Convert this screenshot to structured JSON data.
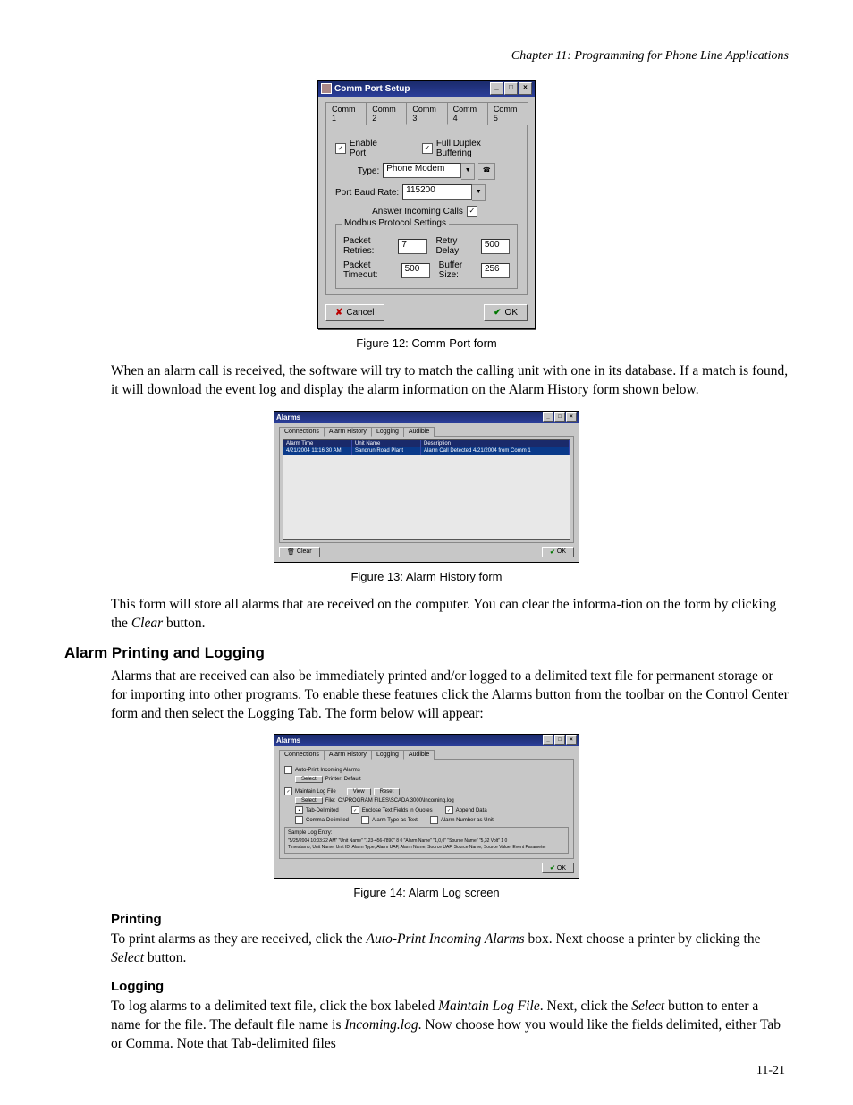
{
  "header": {
    "chapter": "Chapter 11: Programming for Phone Line Applications"
  },
  "dialog1": {
    "title": "Comm Port Setup",
    "tabs": [
      "Comm 1",
      "Comm 2",
      "Comm 3",
      "Comm 4",
      "Comm 5"
    ],
    "enable_port_label": "Enable Port",
    "full_duplex_label": "Full Duplex Buffering",
    "type_label": "Type:",
    "type_value": "Phone Modem",
    "baud_label": "Port Baud Rate:",
    "baud_value": "115200",
    "answer_label": "Answer Incoming Calls",
    "group_title": "Modbus Protocol Settings",
    "packet_retries_label": "Packet Retries:",
    "packet_retries_value": "7",
    "retry_delay_label": "Retry Delay:",
    "retry_delay_value": "500",
    "packet_timeout_label": "Packet Timeout:",
    "packet_timeout_value": "500",
    "buffer_size_label": "Buffer Size:",
    "buffer_size_value": "256",
    "cancel": "Cancel",
    "ok": "OK"
  },
  "fig12": "Figure 12: Comm Port form",
  "para1": "When an alarm call is received, the software will try to match the calling unit with one in its database.  If a match is found, it will download the event log and display the alarm information on the Alarm History form shown below.",
  "dialog2": {
    "title": "Alarms",
    "tabs": [
      "Connections",
      "Alarm History",
      "Logging",
      "Audible"
    ],
    "cols": {
      "c1": "Alarm Time",
      "c2": "Unit Name",
      "c3": "Description"
    },
    "row": {
      "c1": "4/21/2004 11:16:30 AM",
      "c2": "Sandrun Road Plant",
      "c3": "Alarm Call Detected 4/21/2004 from Comm 1"
    },
    "clear": "Clear",
    "ok": "OK"
  },
  "fig13": "Figure 13: Alarm History form",
  "para2a": "This form will store all alarms that are received on the computer.  You can clear the informa-",
  "para2b": "tion on the form by clicking the ",
  "para2c": "Clear",
  "para2d": " button.",
  "heading1": "Alarm Printing and Logging",
  "para3": "Alarms that are received can also be immediately printed and/or logged to a delimited text file for permanent storage or for importing into other programs.  To enable these features click the Alarms button from the toolbar on the Control Center form and then select the Logging Tab.  The form below will appear:",
  "dialog3": {
    "title": "Alarms",
    "tabs": [
      "Connections",
      "Alarm History",
      "Logging",
      "Audible"
    ],
    "auto_print": "Auto-Print Incoming Alarms",
    "select": "Select",
    "printer": "Printer: Default",
    "maintain": "Maintain Log File",
    "view": "View",
    "reset": "Reset",
    "file": "File:",
    "file_path": "C:\\PROGRAM FILES\\SCADA 3000\\Incoming.log",
    "tab_delim": "Tab-Delimited",
    "enclose": "Enclose Text Fields in Quotes",
    "append": "Append Data",
    "comma_delim": "Comma-Delimited",
    "alarm_type_text": "Alarm Type as Text",
    "alarm_num_unit": "Alarm Number as Unit",
    "sample_title": "Sample Log Entry:",
    "sample_line1": "\"5/25/2004 10:03:22 AM\"    \"Unit Name\"    \"123-456-7890\"    8    0    \"Alarm Name\"    \"1,0,0\"    \"Source Name\"    \"5,32 Volt\"    1    0",
    "sample_line2": "Timestamp, Unit Name, Unit ID, Alarm Type, Alarm UAF, Alarm Name, Source UAF, Source Name, Source Value, Event Parameter",
    "ok": "OK"
  },
  "fig14": "Figure 14: Alarm Log screen",
  "heading2": "Printing",
  "para4a": "To print alarms as they are received, click the ",
  "para4b": "Auto-Print Incoming Alarms",
  "para4c": " box.  Next choose a printer by clicking the ",
  "para4d": "Select",
  "para4e": " button.",
  "heading3": "Logging",
  "para5a": "To log alarms to a delimited text file, click the box labeled ",
  "para5b": "Maintain Log File",
  "para5c": ". Next, click the ",
  "para5d": "Select",
  "para5e": " button to enter a name for the file. The default file name is ",
  "para5f": "Incoming.log",
  "para5g": ". Now choose how you would like the fields delimited, either Tab or Comma. Note that Tab-delimited files",
  "pagenum": "11-21"
}
